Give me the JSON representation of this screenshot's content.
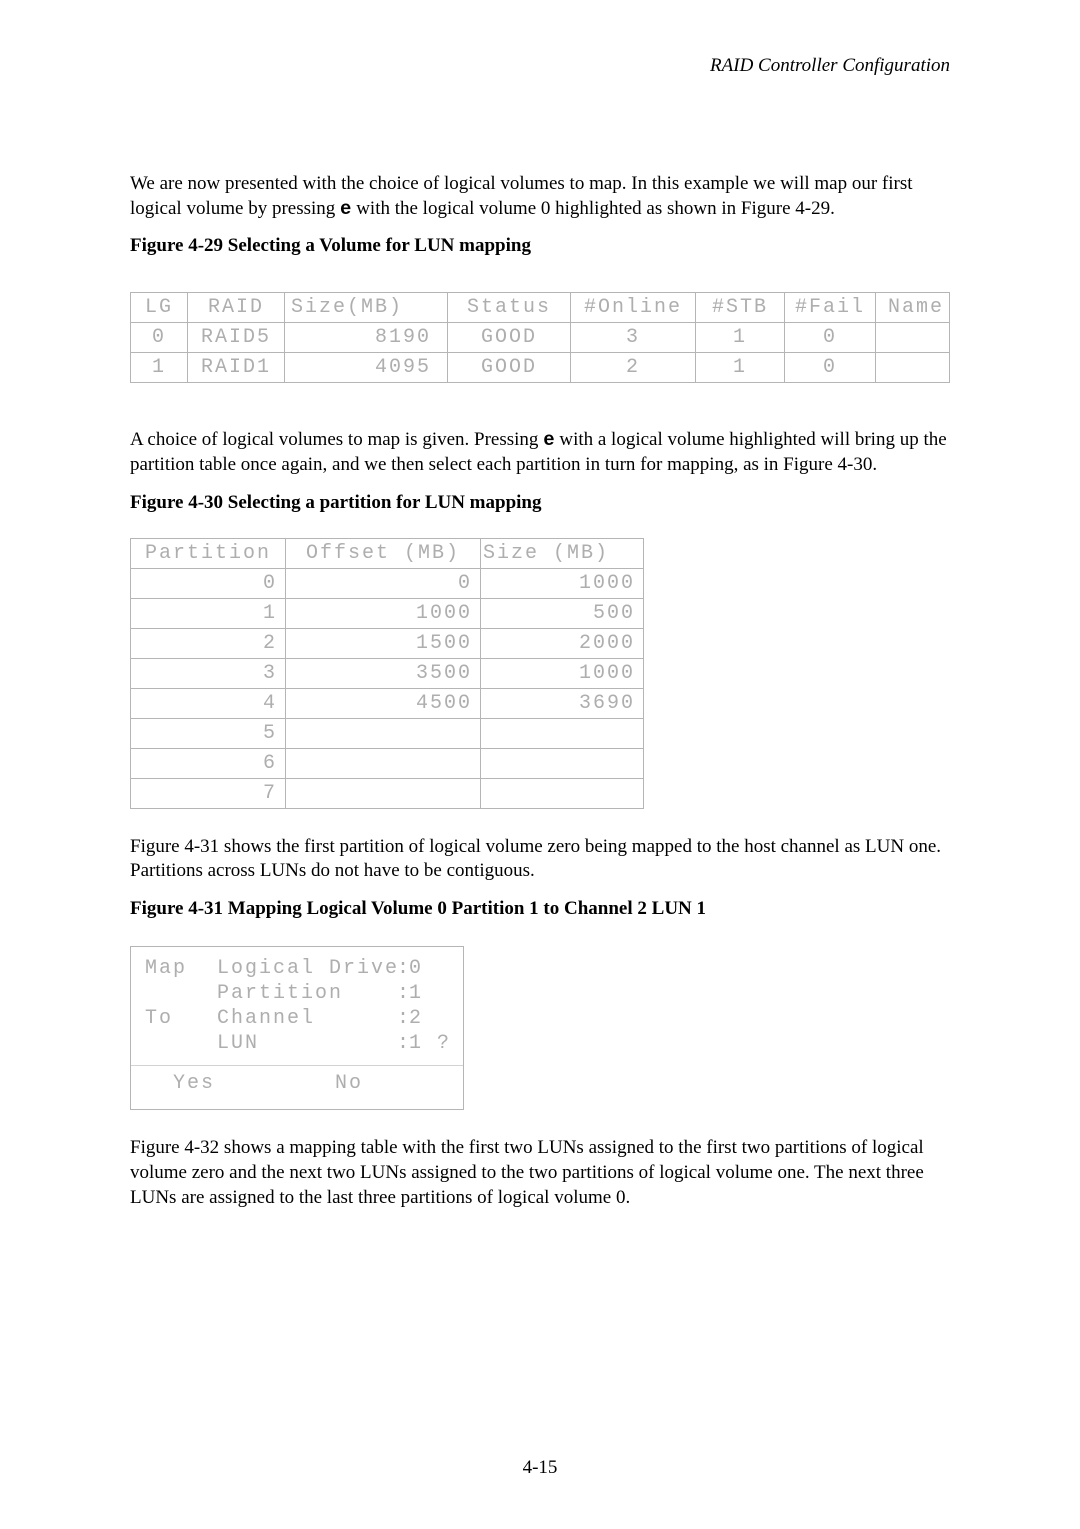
{
  "header": {
    "doc_title": "RAID Controller Configuration"
  },
  "para1": {
    "text_a": "We are now presented with the choice of logical volumes to map. In this example we will map our first logical volume by pressing ",
    "key": "e",
    "text_b": " with the logical volume 0 highlighted as shown in Figure 4-29."
  },
  "fig29": {
    "caption": "Figure 4-29 Selecting a Volume for LUN mapping"
  },
  "vol_table": {
    "headers": {
      "lg": "LG",
      "raid": "RAID",
      "size": "Size(MB)",
      "status": "Status",
      "online": "#Online",
      "stb": "#STB",
      "fail": "#Fail",
      "name": " Name"
    },
    "rows": [
      {
        "lg": "0",
        "raid": "RAID5",
        "size": "8190",
        "status": "GOOD",
        "online": "3",
        "stb": "1",
        "fail": "0",
        "name": ""
      },
      {
        "lg": "1",
        "raid": "RAID1",
        "size": "4095",
        "status": "GOOD",
        "online": "2",
        "stb": "1",
        "fail": "0",
        "name": ""
      }
    ]
  },
  "para2": {
    "text_a": "A choice of logical volumes to map is given. Pressing ",
    "key": "e",
    "text_b": " with a logical volume highlighted will bring up the partition table once again, and we then select each partition in turn for mapping, as in Figure 4-30."
  },
  "fig30": {
    "caption": "Figure 4-30 Selecting a partition for LUN mapping"
  },
  "part_table": {
    "headers": {
      "partition": "Partition",
      "offset": "Offset (MB)",
      "size": "Size (MB)"
    },
    "rows": [
      {
        "partition": "0",
        "offset": "0",
        "size": "1000"
      },
      {
        "partition": "1",
        "offset": "1000",
        "size": "500"
      },
      {
        "partition": "2",
        "offset": "1500",
        "size": "2000"
      },
      {
        "partition": "3",
        "offset": "3500",
        "size": "1000"
      },
      {
        "partition": "4",
        "offset": "4500",
        "size": "3690"
      },
      {
        "partition": "5",
        "offset": "",
        "size": ""
      },
      {
        "partition": "6",
        "offset": "",
        "size": ""
      },
      {
        "partition": "7",
        "offset": "",
        "size": ""
      }
    ]
  },
  "para3": "Figure 4-31 shows the first partition of logical volume zero being mapped to the host channel as LUN one. Partitions across LUNs do not have to be contiguous.",
  "fig31": {
    "caption": "Figure 4-31 Mapping Logical Volume 0 Partition 1 to Channel 2 LUN 1"
  },
  "map_dialog": {
    "map_label": "Map",
    "to_label": "To",
    "fields": {
      "ld_label": "Logical Drive",
      "ld_val": "0",
      "part_label": "Partition",
      "part_val": "1",
      "chan_label": "Channel",
      "chan_val": "2",
      "lun_label": "LUN",
      "lun_val": "1 ?"
    },
    "colon": ":",
    "yes": "Yes",
    "no": "No"
  },
  "para4": "Figure 4-32 shows a mapping table with the first two LUNs assigned to the first two partitions of logical volume zero and the next two LUNs assigned to the two partitions of logical volume one. The next three LUNs are assigned to the last three partitions of logical volume 0.",
  "page_number": "4-15"
}
